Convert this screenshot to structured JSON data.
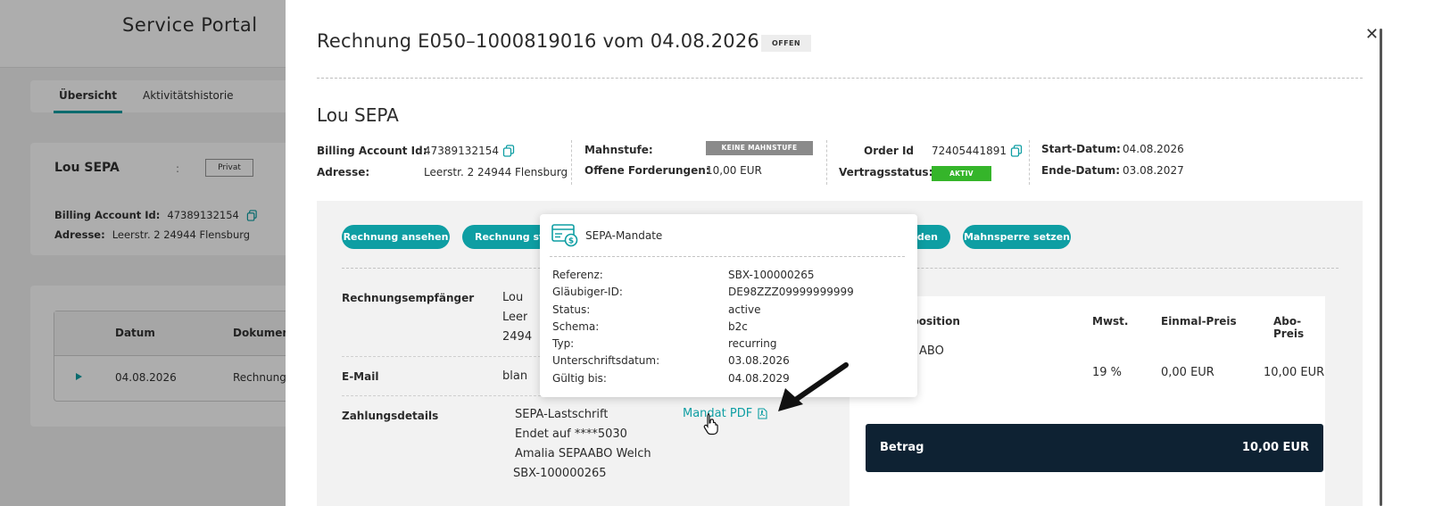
{
  "background": {
    "title": "Service Portal",
    "tabs": [
      {
        "label": "Übersicht"
      },
      {
        "label": "Aktivitätshistorie"
      }
    ],
    "card": {
      "name": "Lou SEPA",
      "colon": ":",
      "badge": "Privat",
      "billing_label": "Billing Account Id:",
      "billing_value": "47389132154",
      "address_label": "Adresse:",
      "address_value": "Leerstr. 2 24944 Flensburg"
    },
    "table": {
      "headers": [
        "Datum",
        "Dokument"
      ],
      "rows": [
        {
          "date": "04.08.2026",
          "doc": "Rechnung"
        }
      ]
    }
  },
  "drawer": {
    "title": "Rechnung E050–1000819016 vom 04.08.2026",
    "status_badge": "OFFEN",
    "customer_name": "Lou SEPA",
    "info": {
      "billing_label": "Billing Account Id:",
      "billing_value": "47389132154",
      "address_label": "Adresse:",
      "address_value": "Leerstr. 2 24944 Flensburg",
      "mahnstufe_label": "Mahnstufe:",
      "mahnstufe_value": "KEINE MAHNSTUFE",
      "forderungen_label": "Offene Forderungen:",
      "forderungen_value": "10,00 EUR",
      "order_label": "Order Id",
      "order_value": "72405441891",
      "vertrag_label": "Vertragsstatus:",
      "vertrag_value": "AKTIV",
      "start_label": "Start-Datum:",
      "start_value": "04.08.2026",
      "ende_label": "Ende-Datum:",
      "ende_value": "03.08.2027"
    },
    "buttons": {
      "rechnung_ansehen": "Rechnung ansehen",
      "rechnung_storno": "Rechnung stor",
      "senden": "nden",
      "mahnsperre": "Mahnsperre setzen"
    },
    "details": {
      "empfaenger_label": "Rechnungsempfänger",
      "empfaenger_lines": [
        "Lou",
        "Leer",
        "2494"
      ],
      "email_label": "E-Mail",
      "email_value": "blan",
      "zahlung_label": "Zahlungsdetails",
      "zahlung_lines": [
        "SEPA-Lastschrift",
        "Endet auf ****5030",
        "Amalia SEPAABO Welch",
        "SBX-100000265"
      ],
      "mandat_link": "Mandat PDF"
    },
    "positions": {
      "headers": {
        "position": "sposition",
        "mwst": "Mwst.",
        "einmal": "Einmal-Preis",
        "abo": "Abo-Preis"
      },
      "row": {
        "name": "ABO",
        "mwst": "19 %",
        "einmal": "0,00 EUR",
        "abo": "10,00 EUR"
      },
      "total_label": "Betrag",
      "total_value": "10,00 EUR"
    }
  },
  "popup": {
    "title": "SEPA-Mandate",
    "rows": [
      {
        "k": "Referenz:",
        "v": "SBX-100000265"
      },
      {
        "k": "Gläubiger-ID:",
        "v": "DE98ZZZ09999999999"
      },
      {
        "k": "Status:",
        "v": "active"
      },
      {
        "k": "Schema:",
        "v": "b2c"
      },
      {
        "k": "Typ:",
        "v": "recurring"
      },
      {
        "k": "Unterschriftsdatum:",
        "v": "03.08.2026"
      },
      {
        "k": "Gültig bis:",
        "v": "04.08.2029"
      }
    ]
  },
  "colors": {
    "accent": "#0e9ea3",
    "navy": "#0e2233",
    "green": "#35b52a",
    "grey_badge": "#8a8a8a"
  }
}
